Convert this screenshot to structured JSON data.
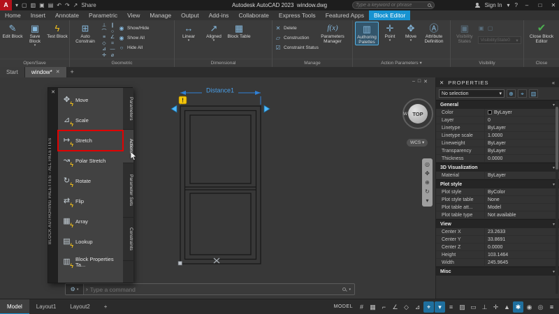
{
  "titlebar": {
    "logo": "A",
    "share_label": "Share",
    "app_title": "Autodesk AutoCAD 2023",
    "doc_name": "window.dwg",
    "search_placeholder": "Type a keyword or phrase",
    "signin_label": "Sign In",
    "help_label": "?"
  },
  "menubar": {
    "tabs": [
      "Home",
      "Insert",
      "Annotate",
      "Parametric",
      "View",
      "Manage",
      "Output",
      "Add-ins",
      "Collaborate",
      "Express Tools",
      "Featured Apps",
      "Block Editor"
    ]
  },
  "ribbon": {
    "open_save": {
      "label": "Open/Save",
      "edit_block": "Edit Block",
      "save_block": "Save Block",
      "test_block": "Test Block"
    },
    "geometric": {
      "label": "Geometric",
      "auto_constrain": "Auto Constrain",
      "show_hide": "Show/Hide",
      "show_all": "Show All",
      "hide_all": "Hide All"
    },
    "dimensional": {
      "label": "Dimensional",
      "linear": "Linear",
      "aligned": "Aligned",
      "block_table": "Block Table"
    },
    "manage": {
      "label": "Manage",
      "delete": "Delete",
      "construction": "Construction",
      "constraint_status": "Constraint Status",
      "fx": "f(x)",
      "parameters_manager": "Parameters Manager"
    },
    "action_parameters": {
      "label": "Action Parameters",
      "authoring_palettes": "Authoring Palettes",
      "point": "Point",
      "move": "Move",
      "attribute_definition": "Attribute Definition"
    },
    "visibility": {
      "label": "Visibility",
      "visibility_states": "Visibility States",
      "state_value": "VisibilityState0"
    },
    "close": {
      "label": "Close",
      "close_block_editor": "Close Block Editor"
    }
  },
  "file_tabs": {
    "start": "Start",
    "doc": "window*",
    "new_tab": "+"
  },
  "palette": {
    "title": "BLOCK AUTHORING PALETTES - ALL PALETTES",
    "items": [
      "Move",
      "Scale",
      "Stretch",
      "Polar Stretch",
      "Rotate",
      "Flip",
      "Array",
      "Lookup",
      "Block Properties Ta..."
    ],
    "item_icons": [
      "✥",
      "⊿",
      "↦",
      "↝",
      "↻",
      "⇄",
      "▦",
      "▤",
      "▥"
    ],
    "highlighted_item": "Stretch",
    "tabs": [
      "Parameters",
      "Actions",
      "Parameter Sets",
      "Constraints"
    ],
    "active_tab": "Actions"
  },
  "canvas": {
    "dimension_label": "Distance1",
    "warning": "!",
    "viewcube_top": "TOP",
    "viewcube_w": "W",
    "wcs": "WCS"
  },
  "command_line": {
    "placeholder": "Type a command"
  },
  "properties": {
    "title": "PROPERTIES",
    "selection": "No selection",
    "sections": [
      {
        "name": "General",
        "rows": [
          [
            "Color",
            "ByLayer"
          ],
          [
            "Layer",
            "0"
          ],
          [
            "Linetype",
            "ByLayer"
          ],
          [
            "Linetype scale",
            "1.0000"
          ],
          [
            "Lineweight",
            "ByLayer"
          ],
          [
            "Transparency",
            "ByLayer"
          ],
          [
            "Thickness",
            "0.0000"
          ]
        ]
      },
      {
        "name": "3D Visualization",
        "rows": [
          [
            "Material",
            "ByLayer"
          ]
        ]
      },
      {
        "name": "Plot style",
        "rows": [
          [
            "Plot style",
            "ByColor"
          ],
          [
            "Plot style table",
            "None"
          ],
          [
            "Plot table att...",
            "Model"
          ],
          [
            "Plot table type",
            "Not available"
          ]
        ]
      },
      {
        "name": "View",
        "rows": [
          [
            "Center X",
            "23.2633"
          ],
          [
            "Center Y",
            "33.8691"
          ],
          [
            "Center Z",
            "0.0000"
          ],
          [
            "Height",
            "103.1464"
          ],
          [
            "Width",
            "245.9645"
          ]
        ]
      },
      {
        "name": "Misc",
        "rows": []
      }
    ]
  },
  "statusbar": {
    "model_tab": "Model",
    "layout1_tab": "Layout1",
    "layout2_tab": "Layout2",
    "new_layout": "+",
    "model_label": "MODEL",
    "icons": [
      {
        "name": "grid",
        "glyph": "#",
        "on": false
      },
      {
        "name": "snap-mode",
        "glyph": "▦",
        "on": false
      },
      {
        "name": "ortho",
        "glyph": "⌐",
        "on": false
      },
      {
        "name": "polar-tracking",
        "glyph": "∠",
        "on": false
      },
      {
        "name": "isodraft",
        "glyph": "◇",
        "on": false
      },
      {
        "name": "object-snap-tracking",
        "glyph": "⊿",
        "on": false
      },
      {
        "name": "object-snap",
        "glyph": "⌖",
        "on": true
      },
      {
        "name": "object-snap-menu",
        "glyph": "▾",
        "on": true
      },
      {
        "name": "lineweight",
        "glyph": "≡",
        "on": false
      },
      {
        "name": "transparency",
        "glyph": "▨",
        "on": false
      },
      {
        "name": "selection-cycling",
        "glyph": "▭",
        "on": false
      },
      {
        "name": "dynamic-ucs",
        "glyph": "⊥",
        "on": false
      },
      {
        "name": "dynamic-input",
        "glyph": "✛",
        "on": false
      },
      {
        "name": "annotation-visibility",
        "glyph": "▲",
        "on": false
      },
      {
        "name": "workspace-switching",
        "glyph": "✱",
        "on": true
      },
      {
        "name": "annotation-monitor",
        "glyph": "◉",
        "on": false
      },
      {
        "name": "isolate-objects",
        "glyph": "◎",
        "on": false
      },
      {
        "name": "customize",
        "glyph": "≡",
        "on": false
      }
    ]
  },
  "icons": {
    "caret_down": "▾",
    "caret_right": "›",
    "close": "✕",
    "minimize": "–",
    "maximize": "□",
    "new_file": "▢",
    "open_file": "▥",
    "save_file": "▣",
    "print": "▤",
    "undo": "↶",
    "redo": "↷",
    "share_arrow": "↗",
    "pin_left": "«",
    "edit_block": "✎",
    "save_block": "▣",
    "bolt": "ϟ",
    "auto_constrain": "⊞",
    "show_hide": "◉",
    "show_all": "◉",
    "hide_all": "○",
    "linear": "↔",
    "aligned": "↗",
    "block_table": "▦",
    "delete": "✕",
    "construction": "▱",
    "constraint_status": "☑",
    "authoring_palettes": "▥",
    "point": "✛",
    "move": "✥",
    "attribute_definition": "Ⓐ",
    "visibility_states": "▣",
    "vis_small_1": "▣",
    "vis_small_2": "▢",
    "close_check": "✔",
    "gear": "⚙",
    "select_objects": "⌖",
    "quick_select": "▥",
    "pickadd_toggle": "⊕",
    "geo": [
      "⊥",
      "∥",
      "⌒",
      "○",
      "≡",
      "∠",
      "◇",
      "=",
      "⊿",
      "―",
      "✛",
      "⌀"
    ],
    "nav": [
      "◎",
      "✥",
      "⊕",
      "↻",
      "▾"
    ]
  }
}
